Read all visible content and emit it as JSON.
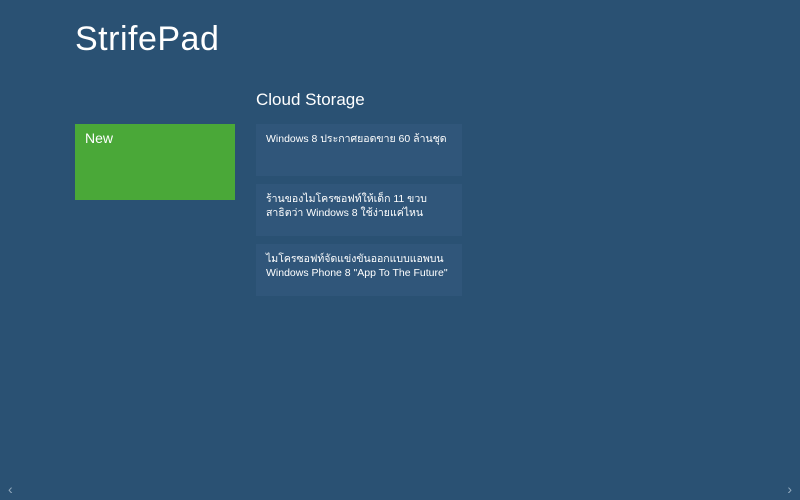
{
  "app": {
    "title": "StrifePad"
  },
  "section": {
    "title": "Cloud Storage"
  },
  "new_tile": {
    "label": "New"
  },
  "colors": {
    "background": "#2a5173",
    "tile_bg": "#30567a",
    "new_bg": "#4aa838",
    "text": "#ffffff"
  },
  "items": [
    {
      "title": "Windows 8 ประกาศยอดขาย 60 ล้านชุด"
    },
    {
      "title": "ร้านของไมโครซอฟท์ให้เด็ก 11 ขวบสาธิตว่า Windows 8 ใช้ง่ายแค่ไหน"
    },
    {
      "title": "ไมโครซอฟท์จัดแข่งขันออกแบบแอพบน Windows Phone 8 \"App To The Future\""
    }
  ],
  "nav": {
    "left_glyph": "‹",
    "right_glyph": "›"
  }
}
